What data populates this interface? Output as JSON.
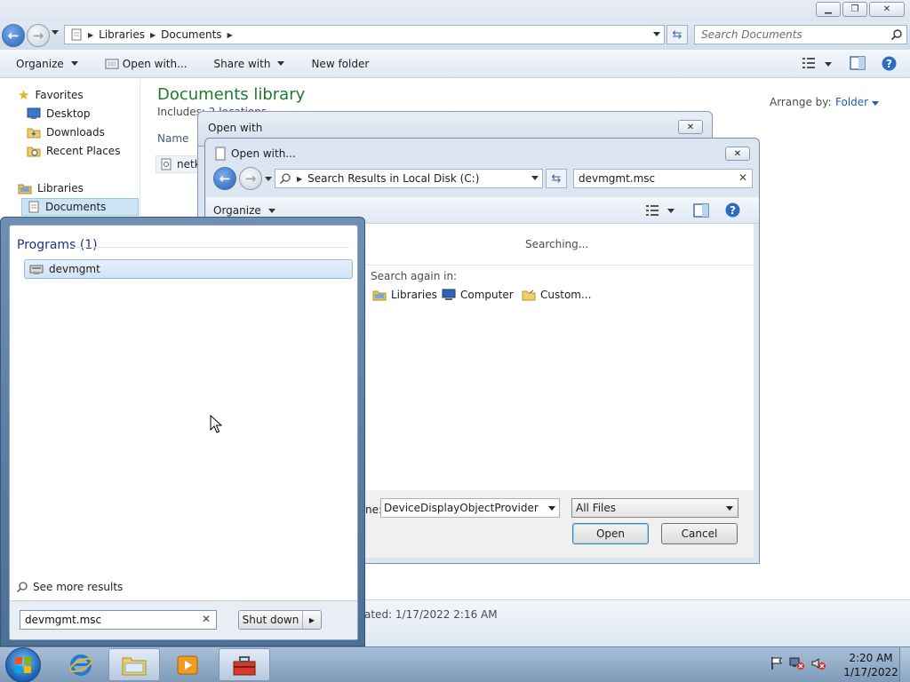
{
  "explorer": {
    "breadcrumb": [
      "Libraries",
      "Documents"
    ],
    "search_placeholder": "Search Documents",
    "commands": {
      "organize": "Organize",
      "open_with": "Open with...",
      "share_with": "Share with",
      "new_folder": "New folder"
    },
    "nav": {
      "favorites": "Favorites",
      "favorites_items": [
        "Desktop",
        "Downloads",
        "Recent Places"
      ],
      "libraries": "Libraries",
      "documents": "Documents"
    },
    "library_title": "Documents library",
    "library_sub": "Includes: 2 locations",
    "arrange_label": "Arrange by:",
    "arrange_value": "Folder",
    "column_name": "Name",
    "file_name": "netk",
    "date_text": "ated: 1/17/2022 2:16 AM"
  },
  "open_with_back": {
    "title": "Open with"
  },
  "open_with_front": {
    "title": "Open with...",
    "address": "Search Results in Local Disk (C:)",
    "search_value": "devmgmt.msc",
    "organize": "Organize",
    "searching": "Searching...",
    "search_again": "Search again in:",
    "locations": [
      "Libraries",
      "Computer",
      "Custom..."
    ],
    "filename_label": "ne:",
    "filename_value": "DeviceDisplayObjectProvider",
    "filter_value": "All Files",
    "open_button": "Open",
    "cancel_button": "Cancel"
  },
  "start_menu": {
    "programs_header": "Programs (1)",
    "program_item": "devmgmt",
    "see_more": "See more results",
    "search_value": "devmgmt.msc",
    "shutdown": "Shut down"
  },
  "taskbar": {
    "time": "2:20 AM",
    "date": "1/17/2022"
  },
  "colors": {
    "accent_green": "#1e7a2e",
    "link_blue": "#1e5fb5",
    "programs_blue": "#1e3287"
  }
}
